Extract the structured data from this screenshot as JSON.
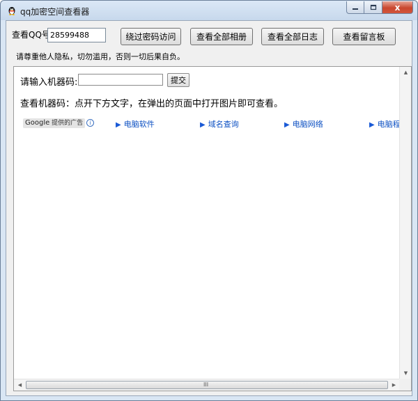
{
  "window": {
    "title": "qq加密空间查看器",
    "close_glyph": "x"
  },
  "toolbar": {
    "qq_label": "查看QQ号",
    "qq_value": "28599488",
    "buttons": [
      {
        "label": "绕过密码访问"
      },
      {
        "label": "查看全部相册"
      },
      {
        "label": "查看全部日志"
      },
      {
        "label": "查看留言板"
      }
    ],
    "warning": "请尊重他人隐私，切勿滥用，否则一切后果自负。"
  },
  "browser": {
    "machine_code_label": "请输入机器码:",
    "machine_code_value": "",
    "submit_label": "提交",
    "instruction": "查看机器码：点开下方文字，在弹出的页面中打开图片即可查看。",
    "ads": {
      "google_prefix": "Google",
      "google_suffix": "提供的广告",
      "info_glyph": "i",
      "links": [
        {
          "label": "电脑软件"
        },
        {
          "label": "域名查询"
        },
        {
          "label": "电脑网络"
        },
        {
          "label": "电脑程序"
        }
      ]
    },
    "scroll_grip": "III"
  },
  "colors": {
    "link": "#0b4fc2",
    "close_button": "#c9472f",
    "title_bar": "#c7d8ec"
  },
  "icons": {
    "app": "qq-penguin-icon",
    "minimize": "minimize-icon",
    "maximize": "maximize-icon",
    "close": "close-icon"
  }
}
